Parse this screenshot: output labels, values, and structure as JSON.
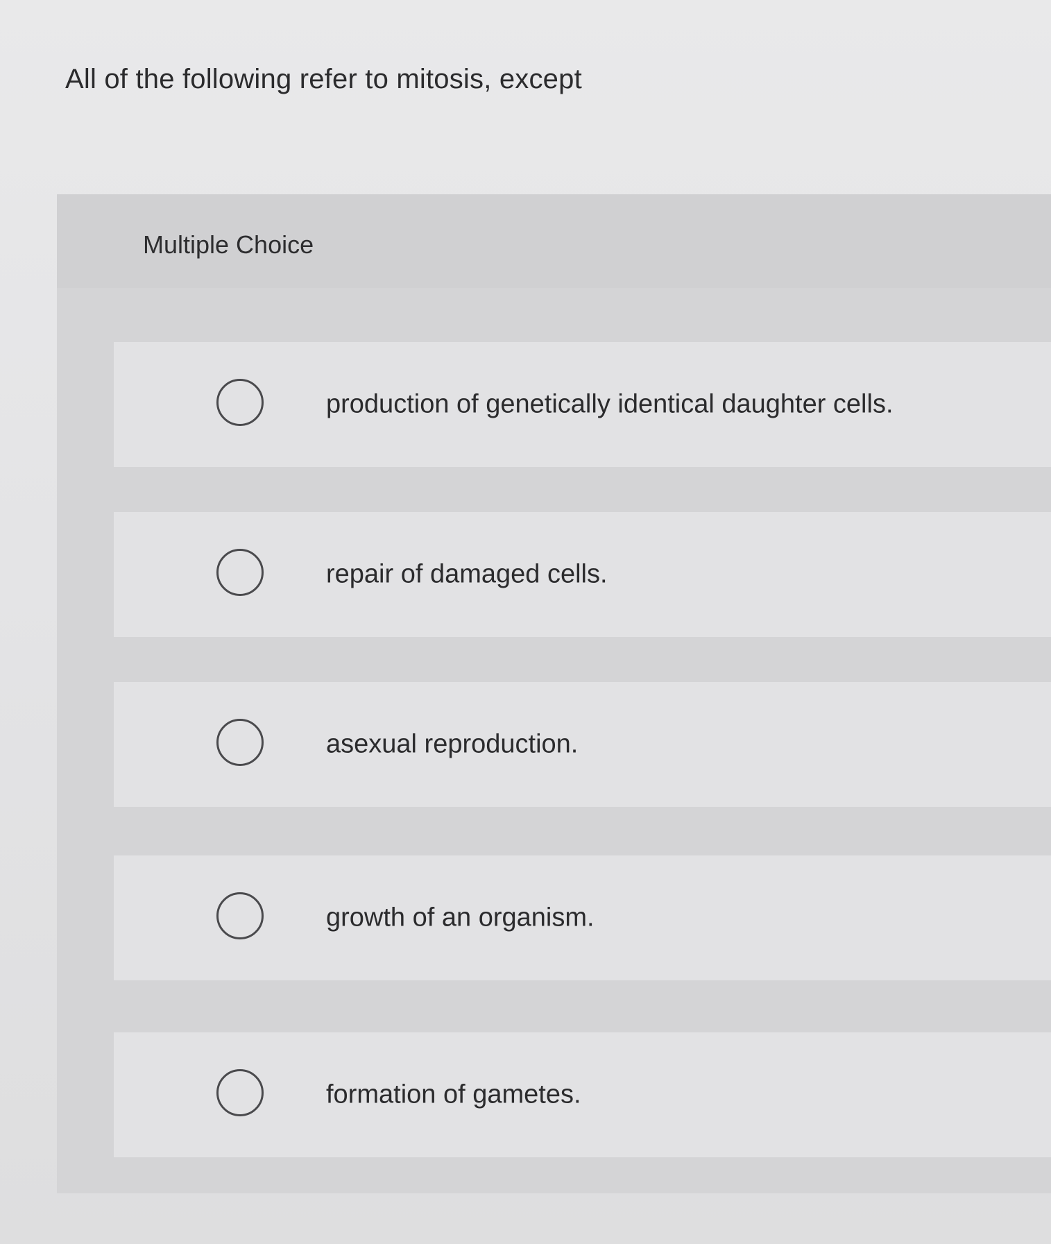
{
  "question": {
    "text": "All of the following refer to mitosis, except"
  },
  "multiple_choice": {
    "label": "Multiple Choice",
    "options": [
      {
        "text": "production of genetically identical daughter cells.",
        "icon": "radio-unselected-icon",
        "selected": false
      },
      {
        "text": "repair of damaged cells.",
        "icon": "radio-unselected-icon",
        "selected": false
      },
      {
        "text": "asexual reproduction.",
        "icon": "radio-unselected-icon",
        "selected": false
      },
      {
        "text": "growth of an organism.",
        "icon": "radio-unselected-icon",
        "selected": false
      },
      {
        "text": "formation of gametes.",
        "icon": "radio-unselected-icon",
        "selected": false
      }
    ]
  }
}
